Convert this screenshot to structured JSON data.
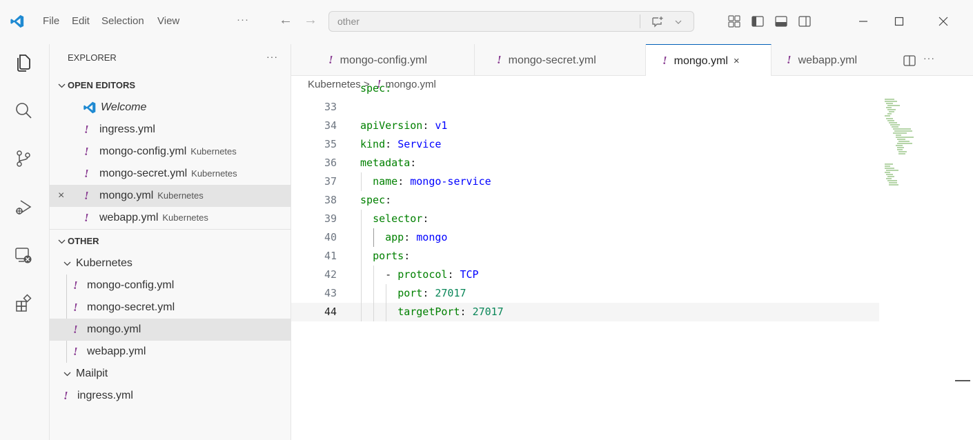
{
  "menu": [
    "File",
    "Edit",
    "Selection",
    "View"
  ],
  "menu_more": "···",
  "search": {
    "value": "other"
  },
  "sidebar": {
    "title": "EXPLORER",
    "more": "···",
    "open_editors": {
      "label": "OPEN EDITORS",
      "items": [
        {
          "name": "Welcome",
          "desc": ""
        },
        {
          "name": "ingress.yml",
          "desc": ""
        },
        {
          "name": "mongo-config.yml",
          "desc": "Kubernetes"
        },
        {
          "name": "mongo-secret.yml",
          "desc": "Kubernetes"
        },
        {
          "name": "mongo.yml",
          "desc": "Kubernetes"
        },
        {
          "name": "webapp.yml",
          "desc": "Kubernetes"
        }
      ]
    },
    "other": {
      "label": "OTHER",
      "folder_kubernetes": "Kubernetes",
      "kubernetes_files": [
        "mongo-config.yml",
        "mongo-secret.yml",
        "mongo.yml",
        "webapp.yml"
      ],
      "folder_mailpit": "Mailpit",
      "root_file": "ingress.yml"
    }
  },
  "tabs": [
    {
      "name": "mongo-config.yml"
    },
    {
      "name": "mongo-secret.yml"
    },
    {
      "name": "mongo.yml",
      "close": "×"
    },
    {
      "name": "webapp.yml"
    }
  ],
  "tabs_more": "···",
  "breadcrumb": {
    "folder": "Kubernetes",
    "sep": ">",
    "file": "mongo.yml"
  },
  "code": {
    "partial_line": "spec:",
    "lines": [
      {
        "n": "33",
        "key": "",
        "val": ""
      },
      {
        "n": "34",
        "key": "apiVersion",
        "val": "v1"
      },
      {
        "n": "35",
        "key": "kind",
        "val": "Service"
      },
      {
        "n": "36",
        "key": "metadata",
        "val": ""
      },
      {
        "n": "37",
        "key": "name",
        "val": "mongo-service"
      },
      {
        "n": "38",
        "key": "spec",
        "val": ""
      },
      {
        "n": "39",
        "key": "selector",
        "val": ""
      },
      {
        "n": "40",
        "key": "app",
        "val": "mongo"
      },
      {
        "n": "41",
        "key": "ports",
        "val": ""
      },
      {
        "n": "42",
        "key": "protocol",
        "val": "TCP"
      },
      {
        "n": "43",
        "key": "port",
        "val": "27017"
      },
      {
        "n": "44",
        "key": "targetPort",
        "val": "27017"
      }
    ]
  },
  "colors": {
    "accent": "#005fb8",
    "yaml_icon": "#8a3e93",
    "key": "#008000",
    "value": "#0000ff",
    "number": "#098658"
  }
}
